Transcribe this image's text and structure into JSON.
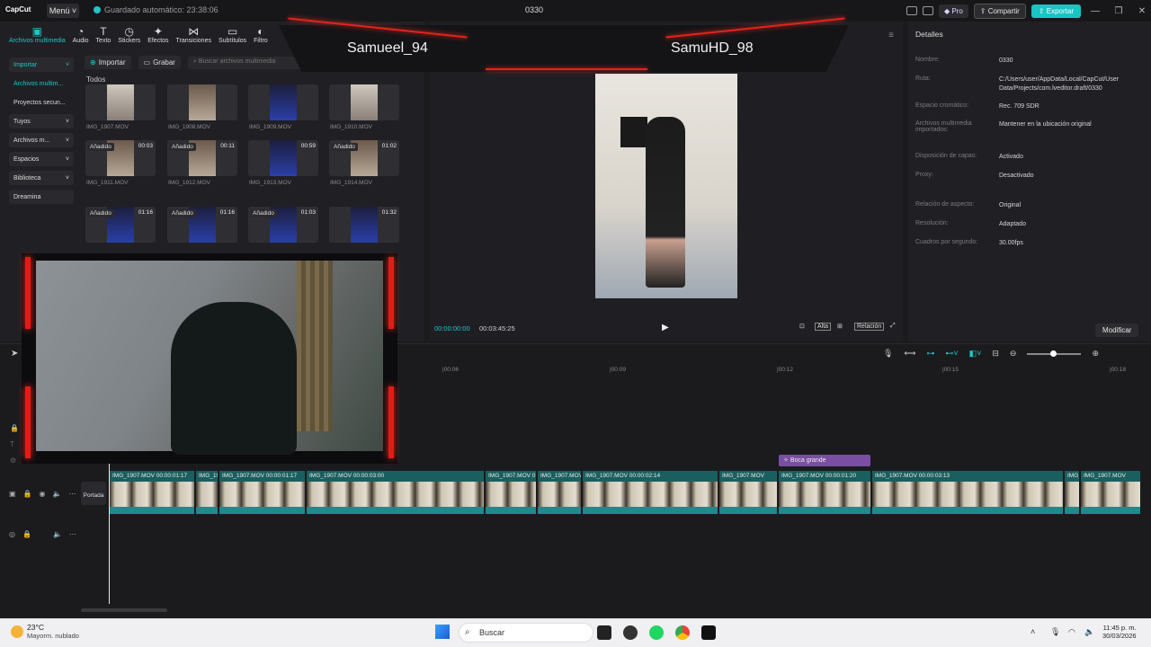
{
  "titlebar": {
    "logo": "CapCut",
    "menu_label": "Menú ˅",
    "autosave": "Guardado automático: 23:38:06",
    "project_name": "0330",
    "pro_label": "Pro",
    "share_label": "Compartir",
    "export_label": "Exportar"
  },
  "tools": [
    {
      "label": "Archivos multimedia",
      "icon": "media-icon"
    },
    {
      "label": "Audio",
      "icon": "audio-icon"
    },
    {
      "label": "Texto",
      "icon": "text-icon"
    },
    {
      "label": "Stickers",
      "icon": "sticker-icon"
    },
    {
      "label": "Efectos",
      "icon": "effects-icon"
    },
    {
      "label": "Transiciones",
      "icon": "transitions-icon"
    },
    {
      "label": "Subtítulos",
      "icon": "subtitles-icon"
    },
    {
      "label": "Filtro",
      "icon": "filter-icon"
    }
  ],
  "sidebar": {
    "items": [
      {
        "label": "Importar",
        "chev": "˅"
      },
      {
        "label": "Archivos multim...",
        "chev": ""
      },
      {
        "label": "Proyectos secun...",
        "chev": ""
      },
      {
        "label": "Tuyos",
        "chev": "˅"
      },
      {
        "label": "Archivos m...",
        "chev": "˅"
      },
      {
        "label": "Espacios",
        "chev": "˅"
      },
      {
        "label": "Biblioteca",
        "chev": "˅"
      },
      {
        "label": "Dreamina",
        "chev": ""
      }
    ]
  },
  "media": {
    "import_label": "Importar",
    "record_label": "Grabar",
    "search_placeholder": "Buscar archivos multimedia",
    "section_label": "Todos",
    "items": [
      {
        "name": "IMG_1907.MOV",
        "badge": "",
        "duration": ""
      },
      {
        "name": "IMG_1908.MOV",
        "badge": "",
        "duration": ""
      },
      {
        "name": "IMG_1909.MOV",
        "badge": "",
        "duration": ""
      },
      {
        "name": "IMG_1910.MOV",
        "badge": "",
        "duration": ""
      },
      {
        "name": "IMG_1911.MOV",
        "badge": "Añadido",
        "duration": "00:03"
      },
      {
        "name": "IMG_1912.MOV",
        "badge": "Añadido",
        "duration": "00:11"
      },
      {
        "name": "IMG_1913.MOV",
        "badge": "",
        "duration": "00:59"
      },
      {
        "name": "IMG_1914.MOV",
        "badge": "Añadido",
        "duration": "01:02"
      },
      {
        "name": "",
        "badge": "Añadido",
        "duration": "01:16"
      },
      {
        "name": "",
        "badge": "Añadido",
        "duration": "01:16"
      },
      {
        "name": "",
        "badge": "Añadido",
        "duration": "01:03"
      },
      {
        "name": "",
        "badge": "",
        "duration": "01:32"
      }
    ]
  },
  "overlay": {
    "player_left": "Samueel_94",
    "player_right": "SamuHD_98"
  },
  "player": {
    "timecode": "00:00:00:00",
    "total": "00:03:45:25",
    "quality_label": "Alta",
    "ratio_label": "Relación"
  },
  "details": {
    "title": "Detalles",
    "rows": [
      {
        "k": "Nombre:",
        "v": "0330"
      },
      {
        "k": "Ruta:",
        "v": "C:/Users/user/AppData/Local/CapCut/User Data/Projects/com.lveditor.draft/0330"
      },
      {
        "k": "Espacio cromático:",
        "v": "Rec. 709 SDR"
      },
      {
        "k": "Archivos multimedia importados:",
        "v": "Mantener en la ubicación original"
      },
      {
        "k": "Disposición de capas:",
        "v": "Activado"
      },
      {
        "k": "Proxy:",
        "v": "Desactivado"
      },
      {
        "k": "Relación de aspecto:",
        "v": "Original"
      },
      {
        "k": "Resolución:",
        "v": "Adaptado"
      },
      {
        "k": "Cuadros por segundo:",
        "v": "30.00fps"
      }
    ],
    "modify_label": "Modificar"
  },
  "timeline": {
    "ruler": [
      "|00:06",
      "|00:09",
      "|00:12",
      "|00:15",
      "|00:18"
    ],
    "effect_clip": "Boca grande",
    "cover_label": "Portada",
    "clips": [
      {
        "label": "IMG_1907.MOV  00:00:01:17"
      },
      {
        "label": "IMG_19"
      },
      {
        "label": "IMG_1907.MOV  00:00:01:17"
      },
      {
        "label": "IMG_1907.MOV  00:00:03:00"
      },
      {
        "label": "IMG_1907.MOV  0"
      },
      {
        "label": "IMG_1907.MOV"
      },
      {
        "label": "IMG_1907.MOV  00:00:02:14"
      },
      {
        "label": "IMG_1907.MOV"
      },
      {
        "label": "IMG_1907.MOV  00:00:01:20"
      },
      {
        "label": "IMG_1907.MOV  00:00:03:13"
      },
      {
        "label": "IMG_1"
      },
      {
        "label": "IMG_1907.MOV"
      }
    ]
  },
  "taskbar": {
    "temperature": "23°C",
    "weather": "Mayorm. nublado",
    "search_label": "Buscar",
    "time": "11:45 p. m.",
    "date": "30/03/2026"
  },
  "colors": {
    "accent": "#1fc6c6",
    "overlay_red": "#e31b17",
    "fx_purple": "#7a4ea2"
  }
}
